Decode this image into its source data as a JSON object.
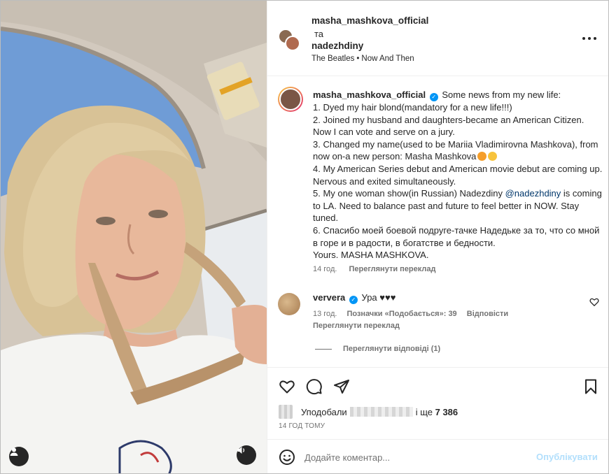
{
  "header": {
    "user1": "masha_mashkova_official",
    "and_text": "та",
    "user2": "nadezhdiny",
    "music_artist": "The Beatles",
    "music_sep": "•",
    "music_track": "Now And Then",
    "more_icon": "more-horizontal-icon"
  },
  "caption": {
    "username": "masha_mashkova_official",
    "verified_icon": "verified-icon",
    "lines": [
      "Some news from my new life:",
      "1. Dyed my hair blond(mandatory for a new life!!!)",
      "2. Joined my husband and daughters-became an American Citizen. Now I can vote and serve on a jury.",
      "3. Changed my name(used to be Mariia Vladimirovna Mashkova), from now on-a new person: Masha Mashkova",
      "4. My American Series debut and American movie debut are coming up. Nervous and exited simultaneously.",
      "5. My one woman show(in Russian) Nadezdiny",
      "@nadezhdiny",
      "is coming to LA. Need to balance past and future to feel better in NOW. Stay tuned.",
      "6. Спасибо моей боевой подруге-тачке Надедьке за то, что со мной в горе и в радости, в богатстве и бедности.",
      "Yours. MASHA MASHKOVA."
    ],
    "time": "14 год.",
    "translate": "Переглянути переклад"
  },
  "comment": {
    "username": "ververa",
    "text": "Ура ♥♥♥",
    "time": "13 год.",
    "likes": "Позначки «Подобається»: 39",
    "reply": "Відповісти",
    "translate": "Переглянути переклад",
    "view_replies": "Переглянути відповіді (1)"
  },
  "actions": {
    "like_icon": "heart-icon",
    "comment_icon": "comment-icon",
    "share_icon": "share-icon",
    "save_icon": "bookmark-icon"
  },
  "likes": {
    "prefix": "Уподобали",
    "suffix": "і ще",
    "count": "7 386"
  },
  "post_time": "14 ГОД ТОМУ",
  "add_comment": {
    "placeholder": "Додайте коментар...",
    "publish": "Опублікувати"
  },
  "colors": {
    "accent": "#0095f6",
    "publish_disabled": "#b2dffc",
    "mention": "#00376b"
  }
}
